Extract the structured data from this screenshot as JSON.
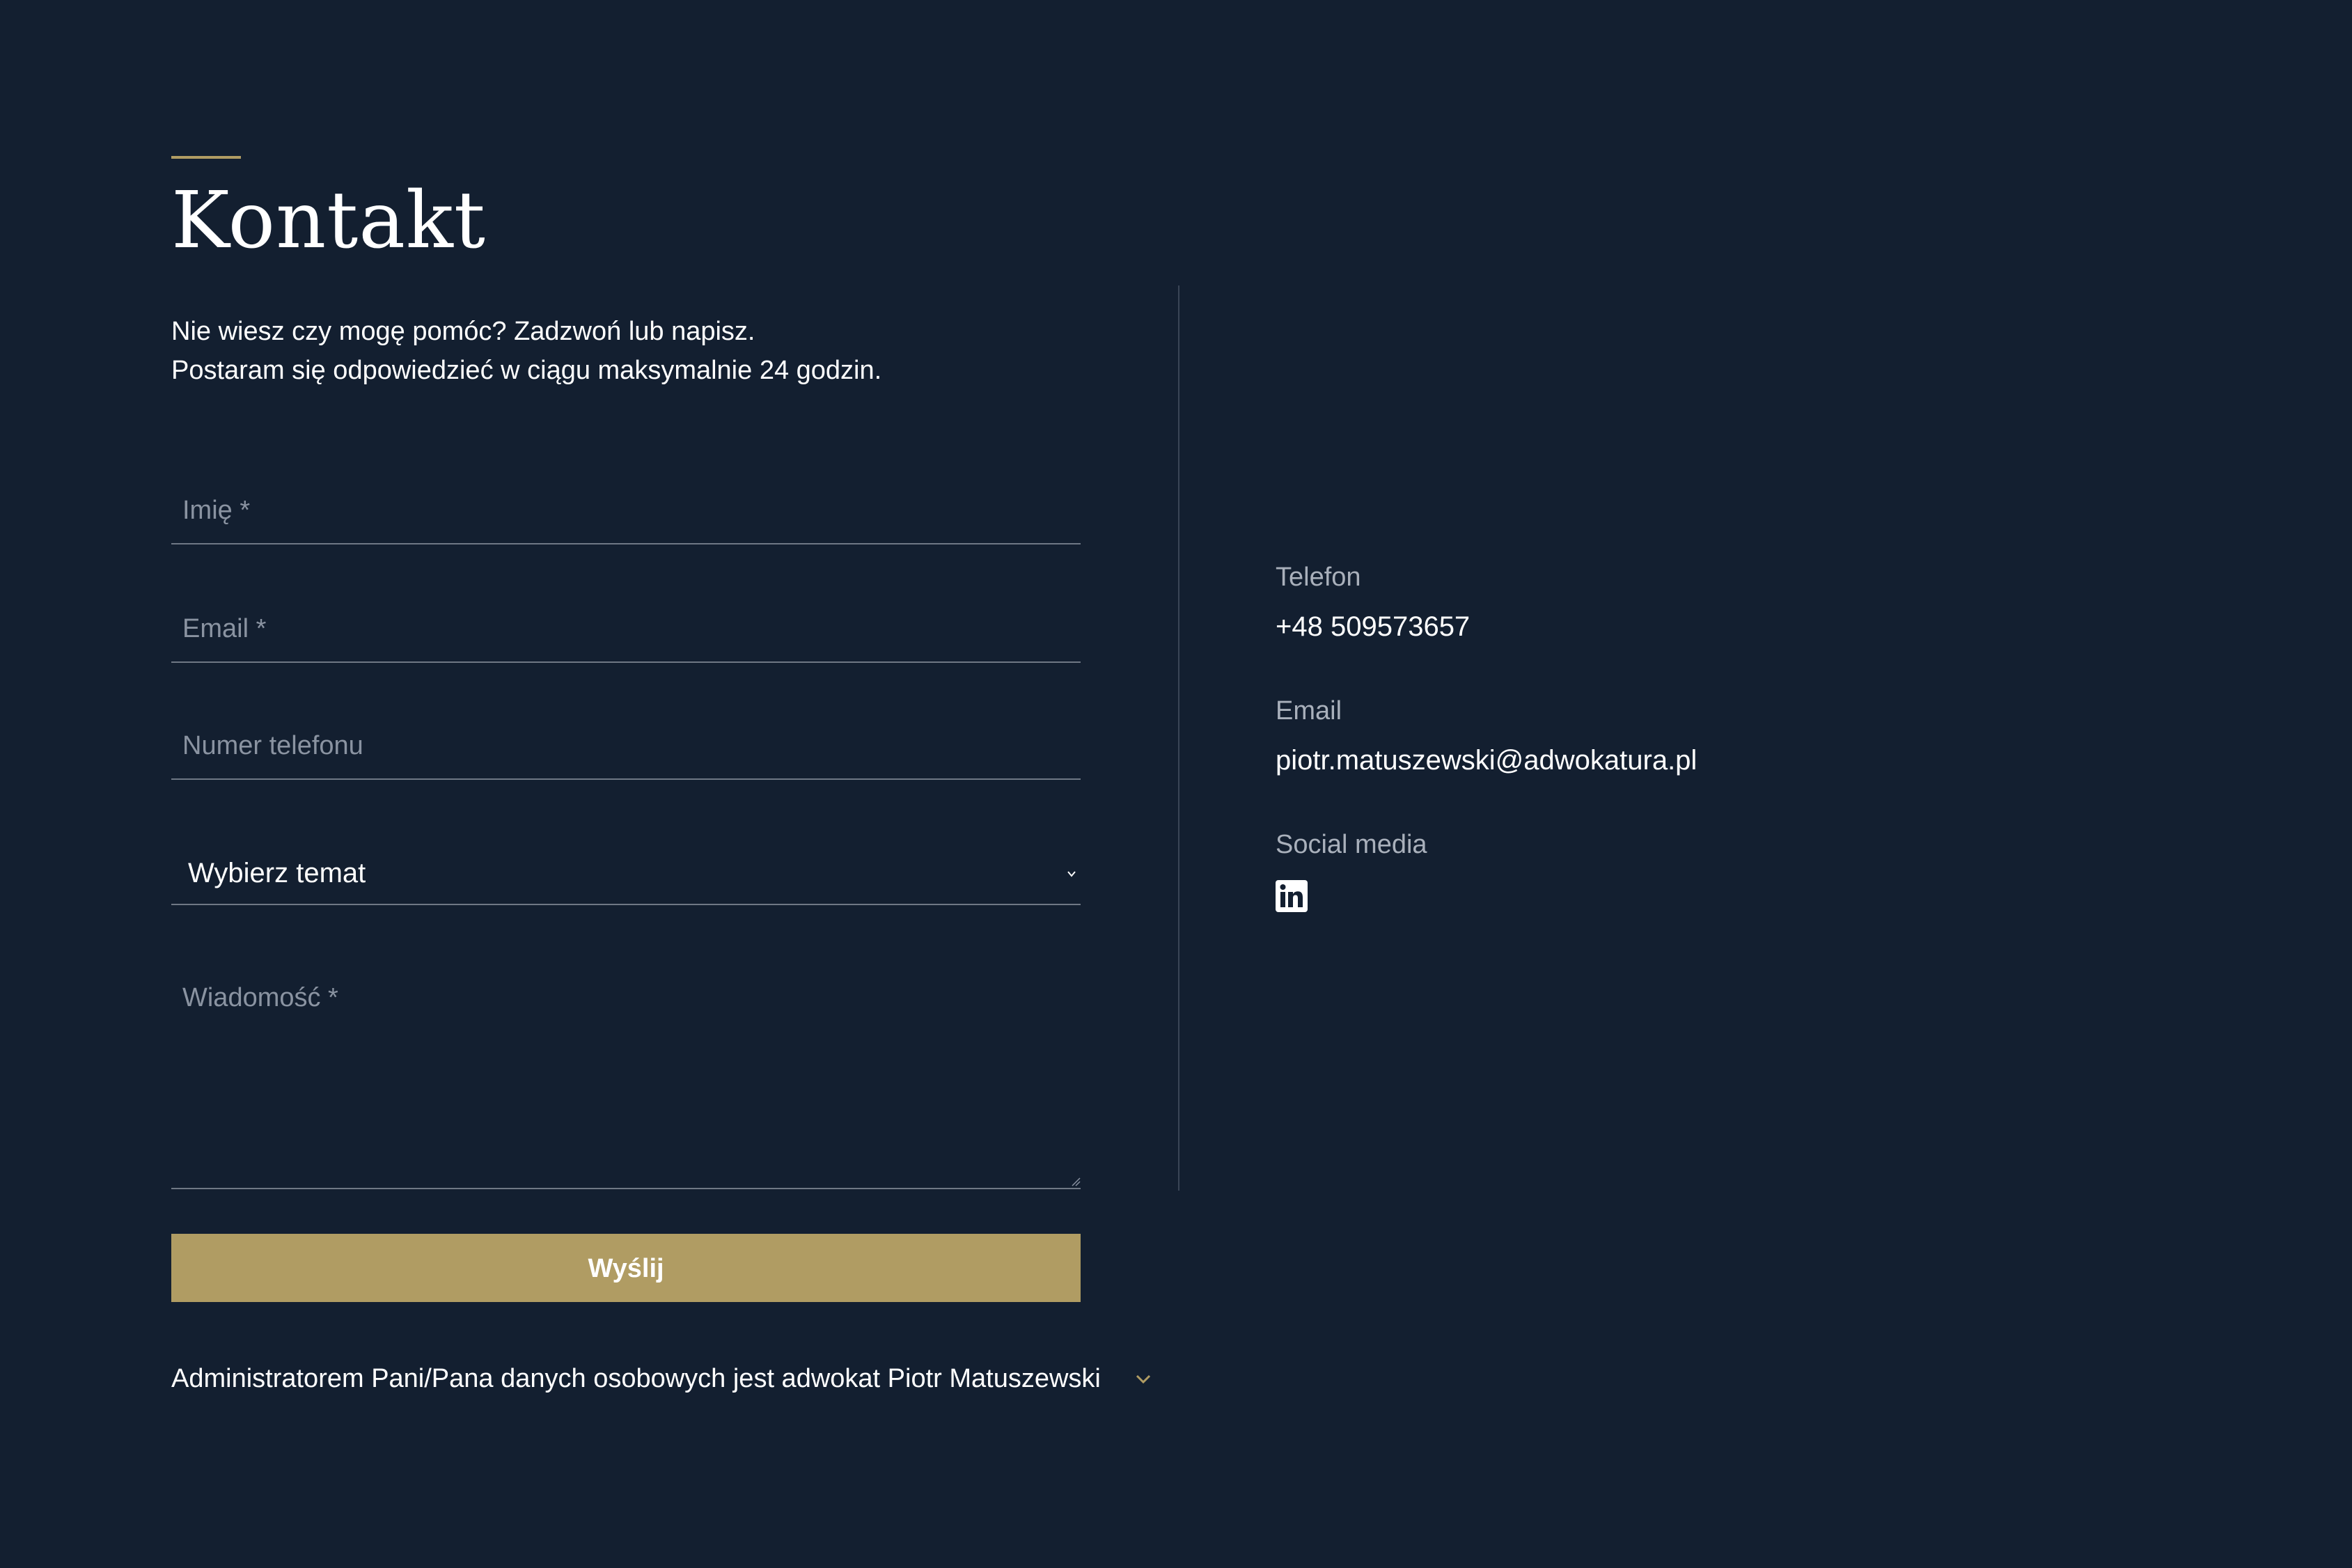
{
  "header": {
    "title": "Kontakt"
  },
  "intro": {
    "line1": "Nie wiesz czy mogę pomóc? Zadzwoń lub napisz.",
    "line2": "Postaram się odpowiedzieć w ciągu maksymalnie 24 godzin."
  },
  "form": {
    "name_placeholder": "Imię *",
    "email_placeholder": "Email *",
    "phone_placeholder": "Numer telefonu",
    "topic_selected": "Wybierz temat",
    "message_placeholder": "Wiadomość *",
    "submit_label": "Wyślij"
  },
  "consent": {
    "text": "Administratorem Pani/Pana danych osobowych jest adwokat Piotr Matuszewski"
  },
  "contact_info": {
    "phone_label": "Telefon",
    "phone_value": "+48 509573657",
    "email_label": "Email",
    "email_value": "piotr.matuszewski@adwokatura.pl",
    "social_label": "Social media",
    "social_icons": [
      "linkedin-icon"
    ]
  },
  "colors": {
    "background": "#131f30",
    "accent": "#b09c63",
    "text": "#ffffff",
    "muted": "#8a93a1"
  }
}
